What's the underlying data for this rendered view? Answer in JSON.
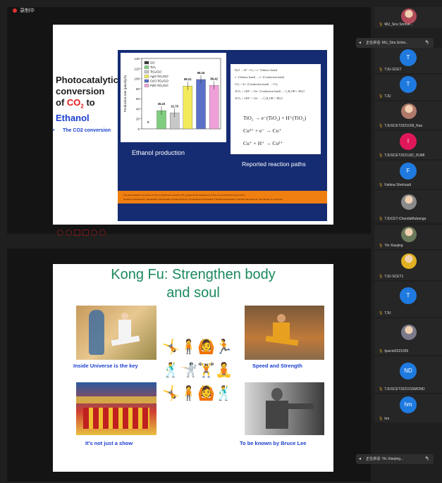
{
  "status": {
    "recording_text": "录制中"
  },
  "slide1": {
    "title_line1": "Photocatalytic",
    "title_line2": "conversion",
    "title_of": "of ",
    "title_co": "CO",
    "title_sub": "2",
    "title_to": " to",
    "title_ethanol": "Ethanol",
    "bullet": "The CO2 conversion",
    "chart_caption": "Ethanol production",
    "reaction_caption": "Reported reaction paths",
    "equations_small": [
      "H₂O → H⁺ + O₂ + e⁻ (Valence band)",
      "e⁻ (Valence band) → e⁻ (Conduction band)",
      "CO₂ + 2e⁻ (Conduction band) → CO₂",
      "2CO₂ + 12H⁺ + 12e⁻ (Conduction band) → C₂H₅OH + 3H₂O",
      "2CO₂ + 12H⁺ + 12e⁻ → C₂H₅OH + 3H₂O"
    ],
    "equations_big": [
      "TiO₂ → e⁻(TiO₂) + H⁺(TiO₂)",
      "Cu²⁺ + e⁻ → Cu⁺",
      "Cu⁺ + H⁺ → Cu²⁺"
    ],
    "footer_lines": [
      "The photocatalytic conversion of CO₂ to liquid fuels using the TiO₂ graphene photocatalyst from the one-pot hydrothermal process",
      "Nopsati Lertcharoensin, Saraphakorn Phamondha, Khelgari Khunpot, Phorapatpimol Samekasit, Thirawat Sanitphirakul, Thandha Kampeasnoll, Soe Sittinan (in progress)"
    ]
  },
  "chart_data": {
    "type": "bar",
    "categories": [
      "GO",
      "TiO₂",
      "TiO₂/GO",
      "AgO-TiO₂/GO",
      "CuO-TiO₂/GO",
      "PdO-TiO₂/GO"
    ],
    "values": [
      0,
      36.23,
      31.75,
      85.21,
      98.15,
      86.42
    ],
    "value_labels": [
      "0",
      "36.23",
      "31.75",
      "85.21",
      "98.15",
      "86.42"
    ],
    "colors": [
      "#3a3a3a",
      "#7fce7f",
      "#c8c8c8",
      "#f2ea5a",
      "#5a6fc8",
      "#f0a0d8"
    ],
    "ylabel": "Production rate (μmol/g·h)",
    "ylim": [
      0,
      140
    ],
    "yticks": [
      0,
      20,
      40,
      60,
      80,
      100,
      120,
      140
    ],
    "title": "",
    "xlabel": ""
  },
  "slide2": {
    "title_line1": "Kong Fu: Strengthen body",
    "title_line2": "and soul",
    "captions": [
      "Inside Universe is the key",
      "Speed and Strength",
      "It's not just a show",
      "To be known by Bruce Lee"
    ],
    "figures": [
      "🤸",
      "🧍",
      "🙆",
      "🏃",
      "🕺",
      "🤺",
      "🏋",
      "🧘",
      "🤸",
      "🧍",
      "🙆",
      "🕺"
    ]
  },
  "participants": [
    {
      "name": "MU_Sira Srinive...",
      "kind": "photo",
      "color": "#b04a5a"
    },
    {
      "name": "TJU-SCET",
      "kind": "letter",
      "letter": "T",
      "color": "#1f7ae0"
    },
    {
      "name": "TJU",
      "kind": "letter",
      "letter": "T",
      "color": "#1f7ae0"
    },
    {
      "name": "TJUSCET2021028_Rao",
      "kind": "photo",
      "color": "#b07a6a"
    },
    {
      "name": "TJUSCET2021182_DUMI",
      "kind": "letter",
      "letter": "I",
      "color": "#e0185a"
    },
    {
      "name": "Fatima Shehzadi",
      "kind": "letter",
      "letter": "F",
      "color": "#1f7ae0"
    },
    {
      "name": "TJUCET-ChandaMubanga",
      "kind": "photo",
      "color": "#8a8a8a"
    },
    {
      "name": "Yin Xiaojing",
      "kind": "photo",
      "color": "#6a7a5a"
    },
    {
      "name": "TJU-SCET1",
      "kind": "photo",
      "color": "#e0b020"
    },
    {
      "name": "TJU",
      "kind": "letter",
      "letter": "T",
      "color": "#1f7ae0"
    },
    {
      "name": "tjuscet2021055",
      "kind": "photo",
      "color": "#7a7a8a"
    },
    {
      "name": "TJUSCET2021015MOND",
      "kind": "letter",
      "letter": "ND",
      "color": "#1f7ae0"
    },
    {
      "name": "hm",
      "kind": "letter",
      "letter": "hm",
      "color": "#1f7ae0"
    }
  ],
  "speakers": {
    "top": "正在讲话: MU_Sira Sriniv...",
    "bottom": "正在讲话: Yin Xiaojing..."
  }
}
